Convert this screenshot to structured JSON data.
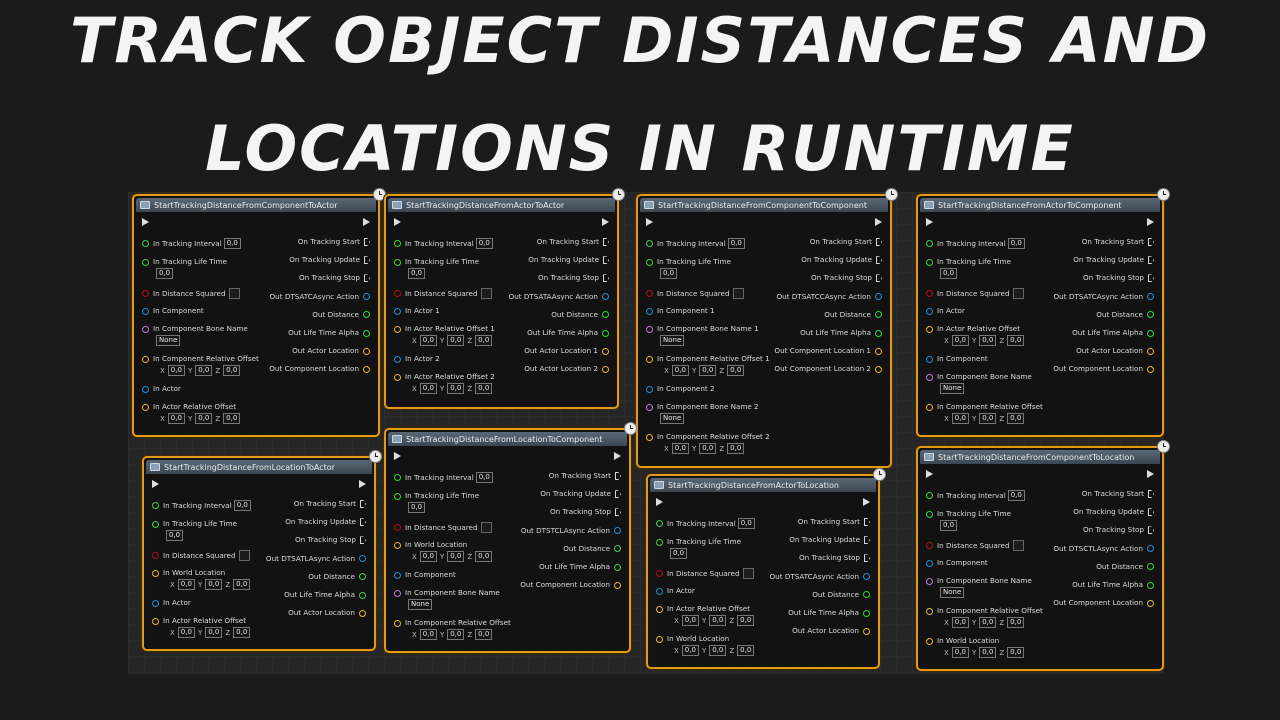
{
  "title": {
    "line1": "TRACK OBJECT DISTANCES AND",
    "line2": "LOCATIONS IN RUNTIME"
  },
  "colors": {
    "node_border": "#e39a17",
    "exec": "#e8e8e8",
    "float": "#3fd13f",
    "bool": "#b01414",
    "object": "#1f8fd8",
    "name": "#c07ad8",
    "vector": "#e7b23a",
    "delegate": "#d8d8d8"
  },
  "labels": {
    "in_tracking_interval": "In Tracking Interval",
    "in_tracking_life_time": "In Tracking Life Time",
    "in_distance_squared": "In Distance Squared",
    "in_component": "In Component",
    "in_component_bone_name": "In Component Bone Name",
    "in_component_relative_offset": "In Component Relative Offset",
    "in_actor": "In Actor",
    "in_actor_relative_offset": "In Actor Relative Offset",
    "in_actor_1": "In Actor 1",
    "in_actor_relative_offset_1": "In Actor Relative Offset 1",
    "in_actor_2": "In Actor 2",
    "in_actor_relative_offset_2": "In Actor Relative Offset 2",
    "in_component_1": "In Component 1",
    "in_component_bone_name_1": "In Component Bone Name 1",
    "in_component_relative_offset_1": "In Component Relative Offset 1",
    "in_component_2": "In Component 2",
    "in_component_bone_name_2": "In Component Bone Name 2",
    "in_component_relative_offset_2": "In Component Relative Offset 2",
    "in_world_location": "In World Location",
    "on_tracking_start": "On Tracking Start",
    "on_tracking_update": "On Tracking Update",
    "on_tracking_stop": "On Tracking Stop",
    "out_distance": "Out Distance",
    "out_life_time_alpha": "Out Life Time Alpha",
    "out_actor_location": "Out Actor Location",
    "out_component_location": "Out Component Location",
    "out_actor_location_1": "Out Actor Location 1",
    "out_actor_location_2": "Out Actor Location 2",
    "out_component_location_1": "Out Component Location 1",
    "out_component_location_2": "Out Component Location 2",
    "x": "X",
    "y": "Y",
    "z": "Z",
    "zero": "0,0",
    "none": "None"
  },
  "nodes": [
    {
      "title": "StartTrackingDistanceFromComponentToActor",
      "async_action": "Out DTSATCAsync Action",
      "inputs": [
        "in_tracking_interval",
        "in_tracking_life_time",
        "in_distance_squared",
        "in_component",
        "in_component_bone_name",
        "in_component_relative_offset",
        "in_actor",
        "in_actor_relative_offset"
      ],
      "outputs": [
        "on_tracking_start",
        "on_tracking_update",
        "on_tracking_stop",
        "async",
        "out_distance",
        "out_life_time_alpha",
        "out_actor_location",
        "out_component_location"
      ]
    },
    {
      "title": "StartTrackingDistanceFromActorToActor",
      "async_action": "Out DTSATAAsync Action",
      "inputs": [
        "in_tracking_interval",
        "in_tracking_life_time",
        "in_distance_squared",
        "in_actor_1",
        "in_actor_relative_offset_1",
        "in_actor_2",
        "in_actor_relative_offset_2"
      ],
      "outputs": [
        "on_tracking_start",
        "on_tracking_update",
        "on_tracking_stop",
        "async",
        "out_distance",
        "out_life_time_alpha",
        "out_actor_location_1",
        "out_actor_location_2"
      ]
    },
    {
      "title": "StartTrackingDistanceFromComponentToComponent",
      "async_action": "Out DTSATCCAsync Action",
      "inputs": [
        "in_tracking_interval",
        "in_tracking_life_time",
        "in_distance_squared",
        "in_component_1",
        "in_component_bone_name_1",
        "in_component_relative_offset_1",
        "in_component_2",
        "in_component_bone_name_2",
        "in_component_relative_offset_2"
      ],
      "outputs": [
        "on_tracking_start",
        "on_tracking_update",
        "on_tracking_stop",
        "async",
        "out_distance",
        "out_life_time_alpha",
        "out_component_location_1",
        "out_component_location_2"
      ]
    },
    {
      "title": "StartTrackingDistanceFromActorToComponent",
      "async_action": "Out DTSATCAsync Action",
      "inputs": [
        "in_tracking_interval",
        "in_tracking_life_time",
        "in_distance_squared",
        "in_actor",
        "in_actor_relative_offset",
        "in_component",
        "in_component_bone_name",
        "in_component_relative_offset"
      ],
      "outputs": [
        "on_tracking_start",
        "on_tracking_update",
        "on_tracking_stop",
        "async",
        "out_distance",
        "out_life_time_alpha",
        "out_actor_location",
        "out_component_location"
      ]
    },
    {
      "title": "StartTrackingDistanceFromLocationToActor",
      "async_action": "Out DTSATLAsync Action",
      "inputs": [
        "in_tracking_interval",
        "in_tracking_life_time",
        "in_distance_squared",
        "in_world_location",
        "in_actor",
        "in_actor_relative_offset"
      ],
      "outputs": [
        "on_tracking_start",
        "on_tracking_update",
        "on_tracking_stop",
        "async",
        "out_distance",
        "out_life_time_alpha",
        "out_actor_location"
      ]
    },
    {
      "title": "StartTrackingDistanceFromLocationToComponent",
      "async_action": "Out DTSTCLAsync Action",
      "inputs": [
        "in_tracking_interval",
        "in_tracking_life_time",
        "in_distance_squared",
        "in_world_location",
        "in_component",
        "in_component_bone_name",
        "in_component_relative_offset"
      ],
      "outputs": [
        "on_tracking_start",
        "on_tracking_update",
        "on_tracking_stop",
        "async",
        "out_distance",
        "out_life_time_alpha",
        "out_component_location"
      ]
    },
    {
      "title": "StartTrackingDistanceFromActorToLocation",
      "async_action": "Out DTSATCAsync Action",
      "inputs": [
        "in_tracking_interval",
        "in_tracking_life_time",
        "in_distance_squared",
        "in_actor",
        "in_actor_relative_offset",
        "in_world_location"
      ],
      "outputs": [
        "on_tracking_start",
        "on_tracking_update",
        "on_tracking_stop",
        "async",
        "out_distance",
        "out_life_time_alpha",
        "out_actor_location"
      ]
    },
    {
      "title": "StartTrackingDistanceFromComponentToLocation",
      "async_action": "Out DTSCTLAsync Action",
      "inputs": [
        "in_tracking_interval",
        "in_tracking_life_time",
        "in_distance_squared",
        "in_component",
        "in_component_bone_name",
        "in_component_relative_offset",
        "in_world_location"
      ],
      "outputs": [
        "on_tracking_start",
        "on_tracking_update",
        "on_tracking_stop",
        "async",
        "out_distance",
        "out_life_time_alpha",
        "out_component_location"
      ]
    }
  ]
}
